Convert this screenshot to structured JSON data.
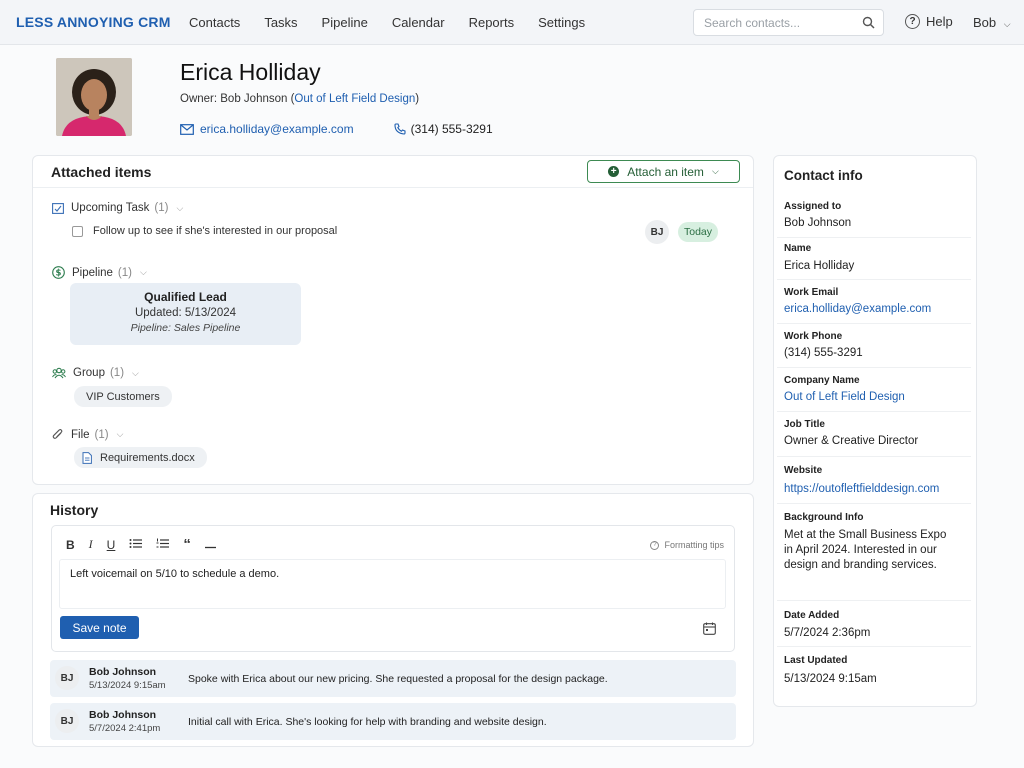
{
  "app": {
    "logo": "LESS ANNOYING CRM",
    "nav": [
      "Contacts",
      "Tasks",
      "Pipeline",
      "Calendar",
      "Reports",
      "Settings"
    ],
    "search_placeholder": "Search contacts...",
    "help": "Help",
    "user": "Bob"
  },
  "contact": {
    "name": "Erica Holliday",
    "owner_prefix": "Owner: Bob Johnson (",
    "owner_company": "Out of Left Field Design",
    "owner_suffix": ")",
    "email": "erica.holliday@example.com",
    "phone": "(314) 555-3291"
  },
  "attached": {
    "title": "Attached items",
    "attach_button": "Attach an item",
    "task": {
      "label": "Upcoming Task",
      "count": "(1)",
      "item": "Follow up to see if she's interested in our proposal",
      "assignee": "BJ",
      "due": "Today"
    },
    "pipeline": {
      "label": "Pipeline",
      "count": "(1)",
      "stage": "Qualified Lead",
      "updated": "Updated: 5/13/2024",
      "pipeline": "Pipeline: Sales Pipeline"
    },
    "group": {
      "label": "Group",
      "count": "(1)",
      "item": "VIP Customers"
    },
    "file": {
      "label": "File",
      "count": "(1)",
      "item": "Requirements.docx"
    }
  },
  "history": {
    "title": "History",
    "toolbar": [
      "B",
      "I",
      "U"
    ],
    "formatting_tips": "Formatting tips",
    "note_text": "Left voicemail on 5/10 to schedule a demo.",
    "save_button": "Save note",
    "entries": [
      {
        "initials": "BJ",
        "author": "Bob Johnson",
        "timestamp": "5/13/2024 9:15am",
        "text": "Spoke with Erica about our new pricing.  She requested a proposal for the design package."
      },
      {
        "initials": "BJ",
        "author": "Bob Johnson",
        "timestamp": "5/7/2024 2:41pm",
        "text": "Initial call with Erica.  She's looking for help with branding and website design."
      }
    ]
  },
  "contact_info": {
    "title": "Contact info",
    "fields": [
      {
        "label": "Assigned to",
        "value": "Bob Johnson"
      },
      {
        "label": "Name",
        "value": "Erica Holliday"
      },
      {
        "label": "Work Email",
        "value": "erica.holliday@example.com"
      },
      {
        "label": "Work Phone",
        "value": "(314) 555-3291"
      },
      {
        "label": "Company Name",
        "value": "Out of Left Field Design"
      },
      {
        "label": "Job Title",
        "value": "Owner & Creative Director"
      },
      {
        "label": "Website",
        "value": "https://outofleftfielddesign.com"
      },
      {
        "label": "Background Info",
        "value": "Met at the Small Business Expo in April 2024.  Interested in our design and branding services."
      },
      {
        "label": "Date Added",
        "value": "5/7/2024 2:36pm"
      },
      {
        "label": "Last Updated",
        "value": "5/13/2024 9:15am"
      }
    ]
  },
  "colors": {
    "brand": "#1f5fb0",
    "accent_green": "#245e36",
    "today_badge": "#d7efe0"
  }
}
